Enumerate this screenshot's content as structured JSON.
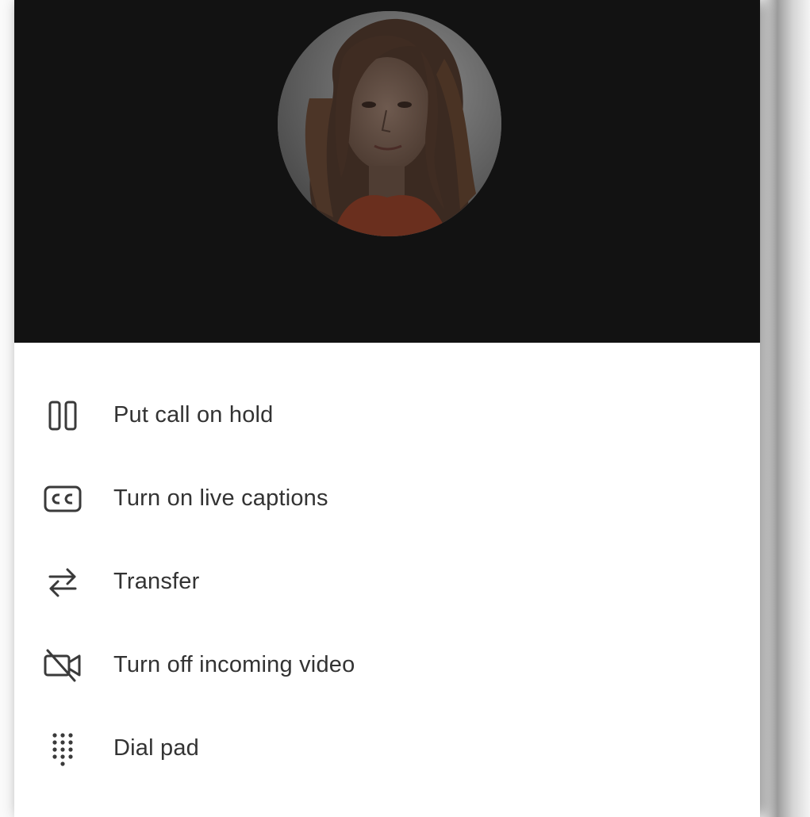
{
  "caller": {
    "avatar_description_icon": "caller-avatar-photo"
  },
  "menu": {
    "items": [
      {
        "label": "Put call on hold",
        "icon": "pause-icon"
      },
      {
        "label": "Turn on live captions",
        "icon": "closed-captions-icon"
      },
      {
        "label": "Transfer",
        "icon": "transfer-arrows-icon"
      },
      {
        "label": "Turn off incoming video",
        "icon": "video-off-icon"
      },
      {
        "label": "Dial pad",
        "icon": "dial-pad-icon"
      }
    ]
  },
  "colors": {
    "stage_background": "#121212",
    "sheet_background": "#ffffff",
    "text": "#333333",
    "icon": "#3a3a3a"
  }
}
